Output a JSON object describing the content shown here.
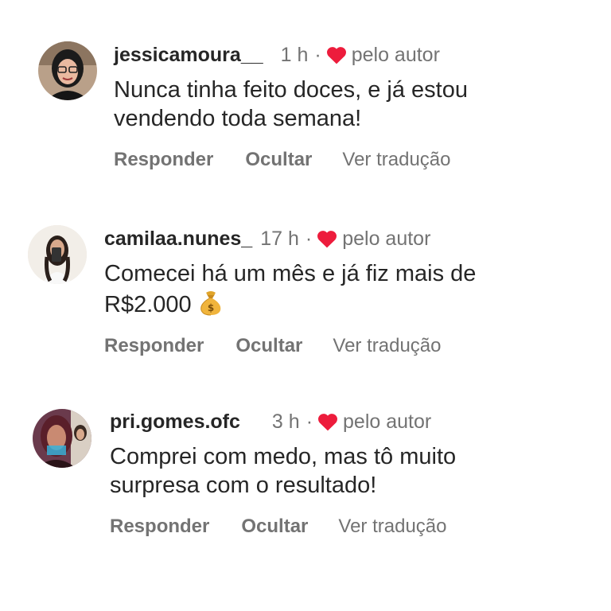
{
  "comments": [
    {
      "username": "jessicamoura__",
      "time": "1 h",
      "separator": "·",
      "liked_by_author": "pelo autor",
      "text_line1": "Nunca tinha feito doces, e já estou",
      "text_line2": "vendendo toda semana!",
      "actions": {
        "reply": "Responder",
        "hide": "Ocultar",
        "translate": "Ver tradução"
      }
    },
    {
      "username": "camilaa.nunes_",
      "time": "17 h",
      "separator": "·",
      "liked_by_author": "pelo autor",
      "text_line1": "Comecei há um mês e já fiz mais de",
      "text_line2": "R$2.000",
      "text_emoji": "money-bag-icon",
      "actions": {
        "reply": "Responder",
        "hide": "Ocultar",
        "translate": "Ver tradução"
      }
    },
    {
      "username": "pri.gomes.ofc",
      "time": "3 h",
      "separator": "·",
      "liked_by_author": "pelo autor",
      "text_line1": "Comprei com medo, mas tô muito",
      "text_line2": "surpresa com o resultado!",
      "actions": {
        "reply": "Responder",
        "hide": "Ocultar",
        "translate": "Ver tradução"
      }
    }
  ],
  "colors": {
    "heart": "#ed1c3c",
    "text": "#262626",
    "muted": "#737373"
  }
}
